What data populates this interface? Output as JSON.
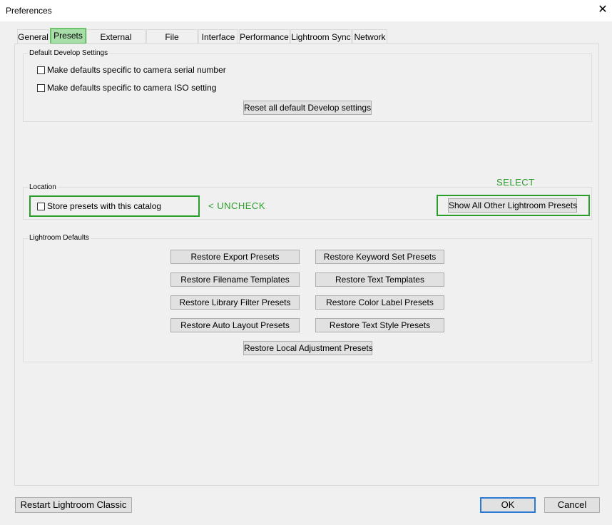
{
  "window": {
    "title": "Preferences",
    "close_glyph": "✕"
  },
  "tabs": [
    {
      "label": "General"
    },
    {
      "label": "Presets",
      "active": true
    },
    {
      "label": "External Editing"
    },
    {
      "label": "File Handling"
    },
    {
      "label": "Interface"
    },
    {
      "label": "Performance"
    },
    {
      "label": "Lightroom Sync"
    },
    {
      "label": "Network"
    }
  ],
  "default_develop": {
    "legend": "Default Develop Settings",
    "serial_label": "Make defaults specific to camera serial number",
    "serial_checked": false,
    "iso_label": "Make defaults specific to camera ISO setting",
    "iso_checked": false,
    "reset_button": "Reset all default Develop settings"
  },
  "location": {
    "legend": "Location",
    "store_label": "Store presets with this catalog",
    "store_checked": false,
    "show_button": "Show All Other Lightroom Presets"
  },
  "annotations": {
    "select": "SELECT",
    "uncheck": "< UNCHECK",
    "color": "#2a9d2a"
  },
  "defaults": {
    "legend": "Lightroom Defaults",
    "buttons": [
      "Restore Export Presets",
      "Restore Keyword Set Presets",
      "Restore Filename Templates",
      "Restore Text Templates",
      "Restore Library Filter Presets",
      "Restore Color Label Presets",
      "Restore Auto Layout Presets",
      "Restore Text Style Presets",
      "Restore Local Adjustment Presets"
    ]
  },
  "footer": {
    "restart": "Restart Lightroom Classic",
    "ok": "OK",
    "cancel": "Cancel"
  }
}
